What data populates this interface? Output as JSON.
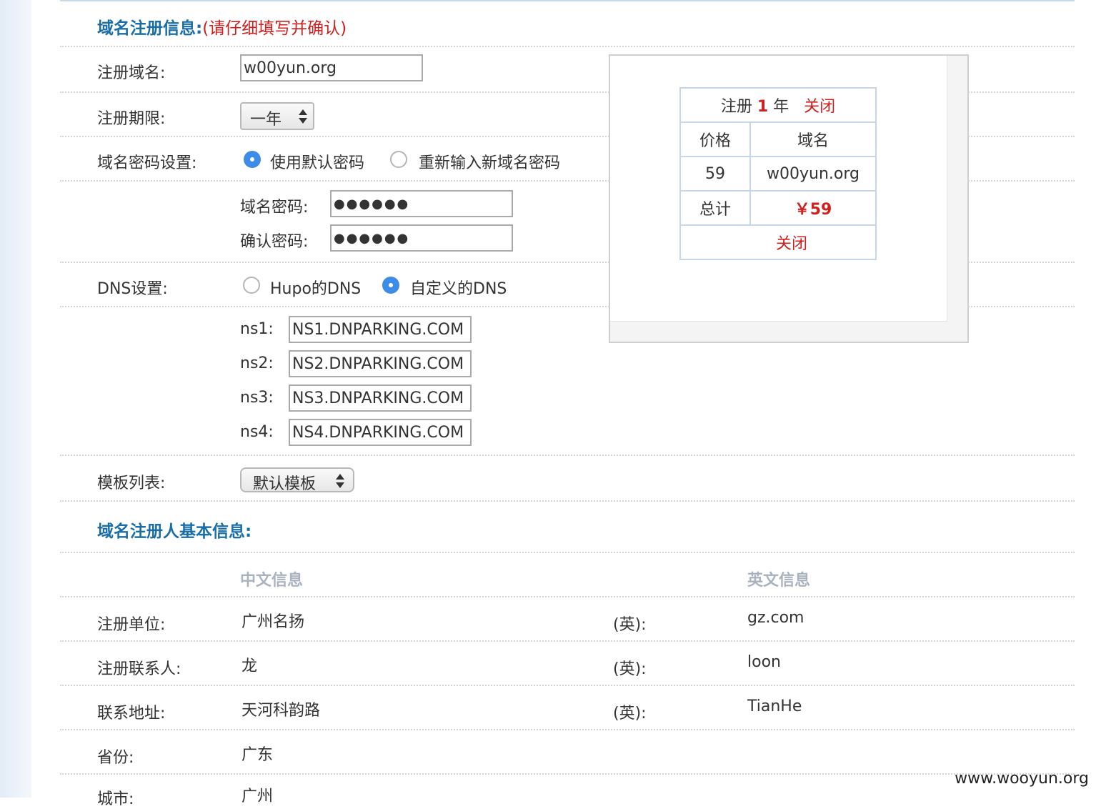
{
  "section1": {
    "title": "域名注册信息:",
    "note": "(请仔细填写并确认)"
  },
  "fields": {
    "domain": {
      "label": "注册域名:",
      "value": "w00yun.org"
    },
    "period": {
      "label": "注册期限:",
      "selected": "一年"
    },
    "password_setting": {
      "label": "域名密码设置:",
      "option_default": "使用默认密码",
      "option_new": "重新输入新域名密码",
      "selected": "default"
    },
    "password": {
      "label": "域名密码:",
      "value": "●●●●●●"
    },
    "confirm": {
      "label": "确认密码:",
      "value": "●●●●●●"
    },
    "dns": {
      "label": "DNS设置:",
      "option_hupo": "Hupo的DNS",
      "option_custom": "自定义的DNS",
      "selected": "custom"
    },
    "ns": [
      {
        "label": "ns1:",
        "value": "NS1.DNPARKING.COM"
      },
      {
        "label": "ns2:",
        "value": "NS2.DNPARKING.COM"
      },
      {
        "label": "ns3:",
        "value": "NS3.DNPARKING.COM"
      },
      {
        "label": "ns4:",
        "value": "NS4.DNPARKING.COM"
      }
    ],
    "template": {
      "label": "模板列表:",
      "selected": "默认模板"
    }
  },
  "section2": {
    "title": "域名注册人基本信息:",
    "col_cn": "中文信息",
    "col_en": "英文信息",
    "rows": [
      {
        "label": "注册单位:",
        "cn": "广州名扬",
        "en_label": "(英):",
        "en": "gz.com"
      },
      {
        "label": "注册联系人:",
        "cn": "龙",
        "en_label": "(英):",
        "en": "loon"
      },
      {
        "label": "联系地址:",
        "cn": "天河科韵路",
        "en_label": "(英):",
        "en": "TianHe"
      },
      {
        "label": "省份:",
        "cn": "广东"
      },
      {
        "label": "城市:",
        "cn": "广州"
      }
    ]
  },
  "popup": {
    "reg_prefix": "注册",
    "years": "1",
    "reg_suffix": "年",
    "close_top": "关闭",
    "col_price": "价格",
    "col_domain": "域名",
    "price": "59",
    "domain": "w00yun.org",
    "total_label": "总计",
    "total_value": "￥59",
    "close_bottom": "关闭"
  },
  "watermark": "www.wooyun.org",
  "colors": {
    "section_title": "#1a6ea8",
    "note": "#d01f1f",
    "radio_on": "#3c8ce8",
    "grey_head": "#a9b3bf"
  }
}
